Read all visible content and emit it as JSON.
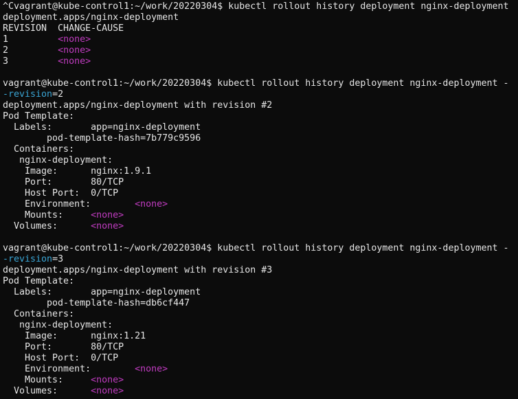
{
  "colors": {
    "background": "#0c0c0c",
    "text": "#e6e6e6",
    "placeholder": "#c13cc1",
    "option": "#3aa6d6"
  },
  "lines": [
    [
      {
        "t": "^Cvagrant@kube-control1:~/work/20220304$ kubectl rollout history deployment nginx-deployment"
      }
    ],
    [
      {
        "t": "deployment.apps/nginx-deployment"
      }
    ],
    [
      {
        "t": "REVISION  CHANGE-CAUSE"
      }
    ],
    [
      {
        "t": "1         "
      },
      {
        "t": "<none>",
        "c": "mag"
      }
    ],
    [
      {
        "t": "2         "
      },
      {
        "t": "<none>",
        "c": "mag"
      }
    ],
    [
      {
        "t": "3         "
      },
      {
        "t": "<none>",
        "c": "mag"
      }
    ],
    [
      {
        "t": ""
      }
    ],
    [
      {
        "t": "vagrant@kube-control1:~/work/20220304$ kubectl rollout history deployment nginx-deployment -"
      }
    ],
    [
      {
        "t": "-revision",
        "c": "cyan"
      },
      {
        "t": "=2"
      }
    ],
    [
      {
        "t": "deployment.apps/nginx-deployment with revision #2"
      }
    ],
    [
      {
        "t": "Pod Template:"
      }
    ],
    [
      {
        "t": "  Labels:       app=nginx-deployment"
      }
    ],
    [
      {
        "t": "        pod-template-hash=7b779c9596"
      }
    ],
    [
      {
        "t": "  Containers:"
      }
    ],
    [
      {
        "t": "   nginx-deployment:"
      }
    ],
    [
      {
        "t": "    Image:      nginx:1.9.1"
      }
    ],
    [
      {
        "t": "    Port:       80/TCP"
      }
    ],
    [
      {
        "t": "    Host Port:  0/TCP"
      }
    ],
    [
      {
        "t": "    Environment:        "
      },
      {
        "t": "<none>",
        "c": "mag"
      }
    ],
    [
      {
        "t": "    Mounts:     "
      },
      {
        "t": "<none>",
        "c": "mag"
      }
    ],
    [
      {
        "t": "  Volumes:      "
      },
      {
        "t": "<none>",
        "c": "mag"
      }
    ],
    [
      {
        "t": ""
      }
    ],
    [
      {
        "t": "vagrant@kube-control1:~/work/20220304$ kubectl rollout history deployment nginx-deployment -"
      }
    ],
    [
      {
        "t": "-revision",
        "c": "cyan"
      },
      {
        "t": "=3"
      }
    ],
    [
      {
        "t": "deployment.apps/nginx-deployment with revision #3"
      }
    ],
    [
      {
        "t": "Pod Template:"
      }
    ],
    [
      {
        "t": "  Labels:       app=nginx-deployment"
      }
    ],
    [
      {
        "t": "        pod-template-hash=db6cf447"
      }
    ],
    [
      {
        "t": "  Containers:"
      }
    ],
    [
      {
        "t": "   nginx-deployment:"
      }
    ],
    [
      {
        "t": "    Image:      nginx:1.21"
      }
    ],
    [
      {
        "t": "    Port:       80/TCP"
      }
    ],
    [
      {
        "t": "    Host Port:  0/TCP"
      }
    ],
    [
      {
        "t": "    Environment:        "
      },
      {
        "t": "<none>",
        "c": "mag"
      }
    ],
    [
      {
        "t": "    Mounts:     "
      },
      {
        "t": "<none>",
        "c": "mag"
      }
    ],
    [
      {
        "t": "  Volumes:      "
      },
      {
        "t": "<none>",
        "c": "mag"
      }
    ]
  ]
}
